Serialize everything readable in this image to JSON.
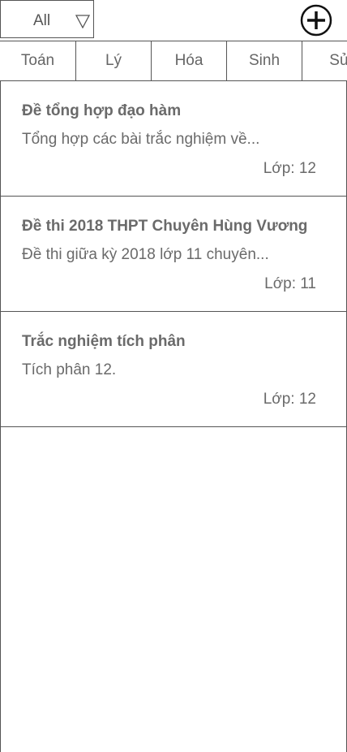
{
  "filter": {
    "selected": "All",
    "arrow_icon": "triangle-down-icon"
  },
  "header": {
    "add_icon": "plus-circle-icon"
  },
  "tabs": [
    {
      "label": "Toán"
    },
    {
      "label": "Lý"
    },
    {
      "label": "Hóa"
    },
    {
      "label": "Sinh"
    },
    {
      "label": "Sử"
    }
  ],
  "exams": [
    {
      "title": "Đề tổng hợp đạo hàm",
      "description": "Tổng hợp các bài trắc nghiệm về...",
      "grade": "Lớp: 12"
    },
    {
      "title": "Đề thi 2018 THPT Chuyên Hùng Vương",
      "description": "Đề thi giữa kỳ 2018 lớp 11 chuyên...",
      "grade": "Lớp: 11"
    },
    {
      "title": "Trắc nghiệm tích phân",
      "description": "Tích phân 12.",
      "grade": "Lớp: 12"
    }
  ]
}
